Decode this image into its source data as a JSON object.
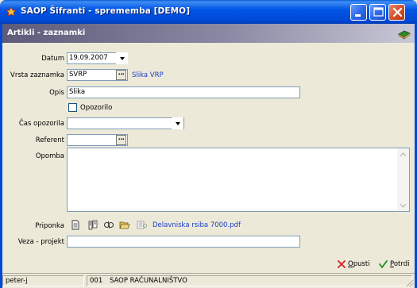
{
  "window": {
    "title": "SAOP Šifranti - sprememba [DEMO]",
    "icons": {
      "app": "saop-app-icon",
      "minimize": "minimize-icon",
      "maximize": "maximize-icon",
      "close": "close-icon"
    }
  },
  "header": {
    "title": "Artikli - zaznamki",
    "icon": "book-icon"
  },
  "form": {
    "datum": {
      "label": "Datum",
      "value": "19.09.2007"
    },
    "vrsta_zaznamka": {
      "label": "Vrsta zaznamka",
      "value": "SVRP",
      "link": "Slika VRP",
      "browse": "..."
    },
    "opis": {
      "label": "Opis",
      "value": "Slika"
    },
    "opozorilo": {
      "label": "Opozorilo",
      "checked": false
    },
    "cas_opozorila": {
      "label": "Čas opozorila",
      "value": ""
    },
    "referent": {
      "label": "Referent",
      "value": "",
      "browse": "..."
    },
    "opomba": {
      "label": "Opomba",
      "value": ""
    },
    "priponka": {
      "label": "Priponka",
      "icons": [
        "new-document-icon",
        "scan-icon",
        "link-icon",
        "open-folder-icon",
        "view-document-icon"
      ],
      "file": "Delavniska rsiba 7000.pdf"
    },
    "veza_projekt": {
      "label": "Veza - projekt",
      "value": ""
    }
  },
  "buttons": {
    "cancel": {
      "accel": "O",
      "rest": "pusti"
    },
    "confirm": {
      "accel": "P",
      "rest": "otrdi"
    }
  },
  "status": {
    "user": "peter-j",
    "code": "001",
    "company": "SAOP RAČUNALNIŠTVO"
  },
  "colors": {
    "accent": "#0055E5",
    "link": "#1A40C8",
    "cancel_x": "#D0202A",
    "confirm_check": "#1F8A1F"
  }
}
